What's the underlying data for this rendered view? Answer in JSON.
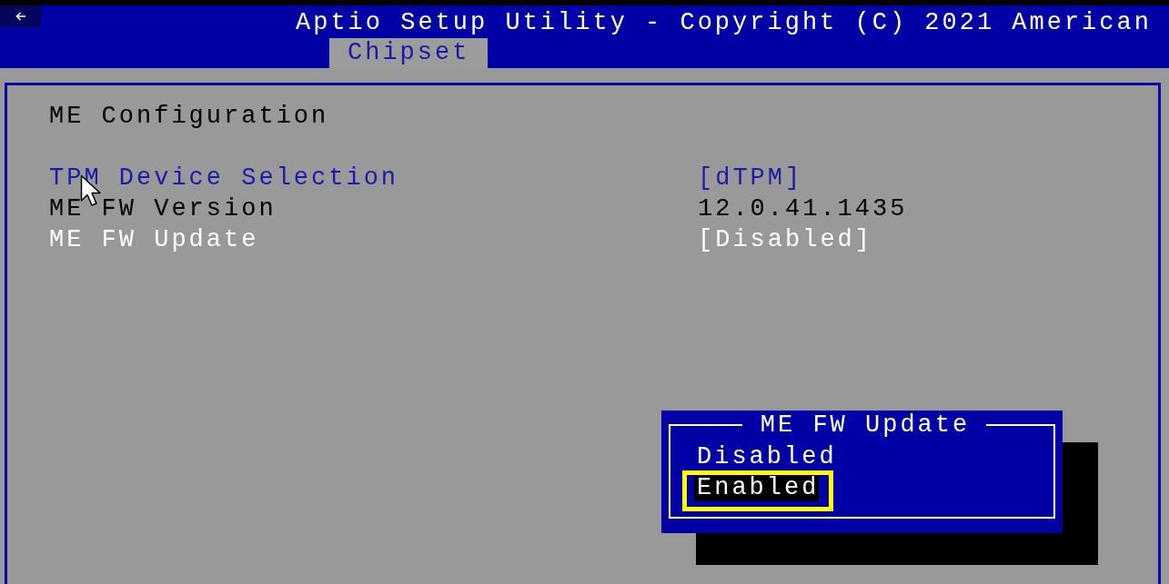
{
  "header": {
    "title": "Aptio Setup Utility - Copyright (C) 2021 American",
    "tabs": [
      {
        "label": "Chipset",
        "selected": true
      }
    ]
  },
  "panel": {
    "heading": "ME Configuration",
    "items": [
      {
        "label": "TPM Device Selection",
        "value": "[dTPM]",
        "kind": "setting",
        "selected": false
      },
      {
        "label": "ME FW Version",
        "value": "12.0.41.1435",
        "kind": "info",
        "selected": false
      },
      {
        "label": "ME FW Update",
        "value": "[Disabled]",
        "kind": "setting",
        "selected": true
      }
    ]
  },
  "popup": {
    "title": "ME FW Update",
    "options": [
      {
        "label": "Disabled",
        "selected": false,
        "outlined": false
      },
      {
        "label": "Enabled",
        "selected": true,
        "outlined": true
      }
    ]
  }
}
